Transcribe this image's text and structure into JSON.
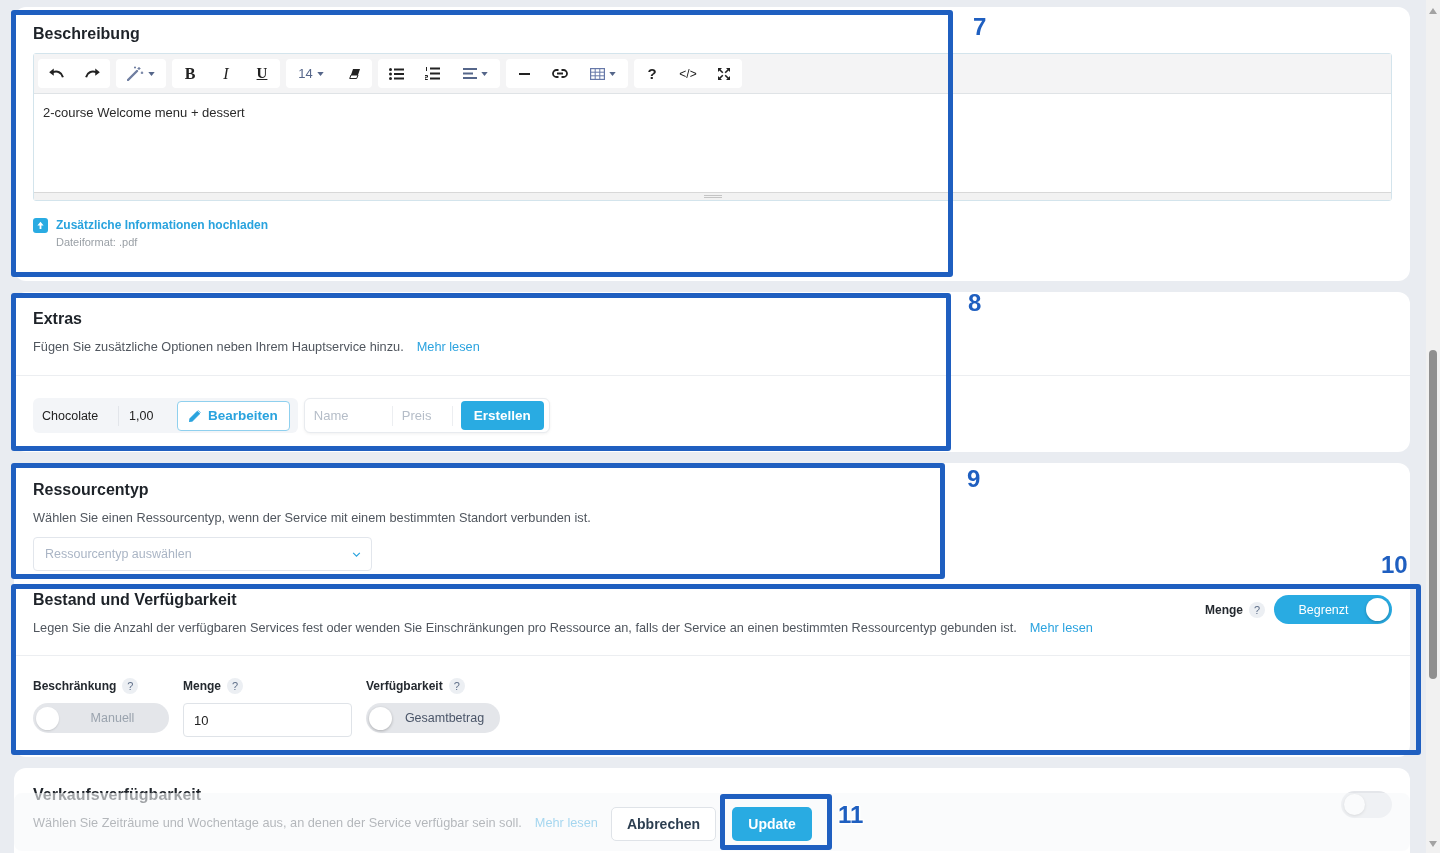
{
  "beschreibung": {
    "title": "Beschreibung",
    "toolbar_groups": [
      {
        "buttons": [
          {
            "kind": "undo",
            "dropdown": false
          },
          {
            "kind": "redo",
            "dropdown": false
          }
        ]
      },
      {
        "buttons": [
          {
            "kind": "magic",
            "dropdown": true
          }
        ]
      },
      {
        "buttons": [
          {
            "kind": "bold",
            "label": "B",
            "dropdown": false
          },
          {
            "kind": "italic",
            "label": "I",
            "dropdown": false
          },
          {
            "kind": "underline",
            "label": "U",
            "dropdown": false
          }
        ]
      },
      {
        "buttons": [
          {
            "kind": "font-size",
            "label": "14",
            "dropdown": true
          },
          {
            "kind": "eraser",
            "dropdown": false
          }
        ]
      },
      {
        "buttons": [
          {
            "kind": "bullet-list",
            "dropdown": false
          },
          {
            "kind": "numbered-list",
            "dropdown": false
          },
          {
            "kind": "align",
            "dropdown": true
          }
        ]
      },
      {
        "buttons": [
          {
            "kind": "rule",
            "dropdown": false
          },
          {
            "kind": "link",
            "dropdown": false
          },
          {
            "kind": "table",
            "dropdown": true
          }
        ]
      },
      {
        "buttons": [
          {
            "kind": "help",
            "label": "?",
            "dropdown": false
          },
          {
            "kind": "code",
            "label": "</>",
            "dropdown": false
          },
          {
            "kind": "fullscreen",
            "dropdown": false
          }
        ]
      }
    ],
    "content": "2-course Welcome menu + dessert",
    "upload_link": "Zusätzliche Informationen hochladen",
    "file_format": "Dateiformat: .pdf"
  },
  "extras": {
    "title": "Extras",
    "description": "Fügen Sie zusätzliche Optionen neben Ihrem Hauptservice hinzu.",
    "more_link": "Mehr lesen",
    "items": [
      {
        "name": "Chocolate",
        "price": "1,00",
        "edit_button": "Bearbeiten"
      }
    ],
    "new_item": {
      "name_placeholder": "Name",
      "price_placeholder": "Preis",
      "create_button": "Erstellen"
    }
  },
  "ressourcentyp": {
    "title": "Ressourcentyp",
    "description": "Wählen Sie einen Ressourcentyp, wenn der Service mit einem bestimmten Standort verbunden ist.",
    "select_placeholder": "Ressourcentyp auswählen"
  },
  "bestand": {
    "title": "Bestand und Verfügbarkeit",
    "description": "Legen Sie die Anzahl der verfügbaren Services fest oder wenden Sie Einschränkungen pro Ressource an, falls der Service an einen bestimmten Ressourcentyp gebunden ist.",
    "more_link": "Mehr lesen",
    "quantity_mode": {
      "label": "Menge",
      "hint": "?",
      "toggle_label": "Begrenzt",
      "on": true
    },
    "fields": [
      {
        "kind": "toggle",
        "label": "Beschränkung",
        "hint": "?",
        "toggle_label": "Manuell",
        "on": false,
        "disabled": true
      },
      {
        "kind": "input",
        "label": "Menge",
        "hint": "?",
        "value": "10"
      },
      {
        "kind": "toggle",
        "label": "Verfügbarkeit",
        "hint": "?",
        "toggle_label": "Gesamtbetrag",
        "on": false,
        "disabled": false
      }
    ]
  },
  "verkaufsverfuegbarkeit": {
    "title": "Verkaufsverfügbarkeit",
    "description": "Wählen Sie Zeiträume und Wochentage aus, an denen der Service verfügbar sein soll.",
    "more_link": "Mehr lesen",
    "on": false
  },
  "footer": {
    "buttons": [
      {
        "kind": "secondary",
        "label": "Abbrechen"
      },
      {
        "kind": "primary",
        "label": "Update"
      }
    ]
  },
  "annotations": [
    {
      "number": "7"
    },
    {
      "number": "8"
    },
    {
      "number": "9"
    },
    {
      "number": "10"
    },
    {
      "number": "11"
    }
  ]
}
